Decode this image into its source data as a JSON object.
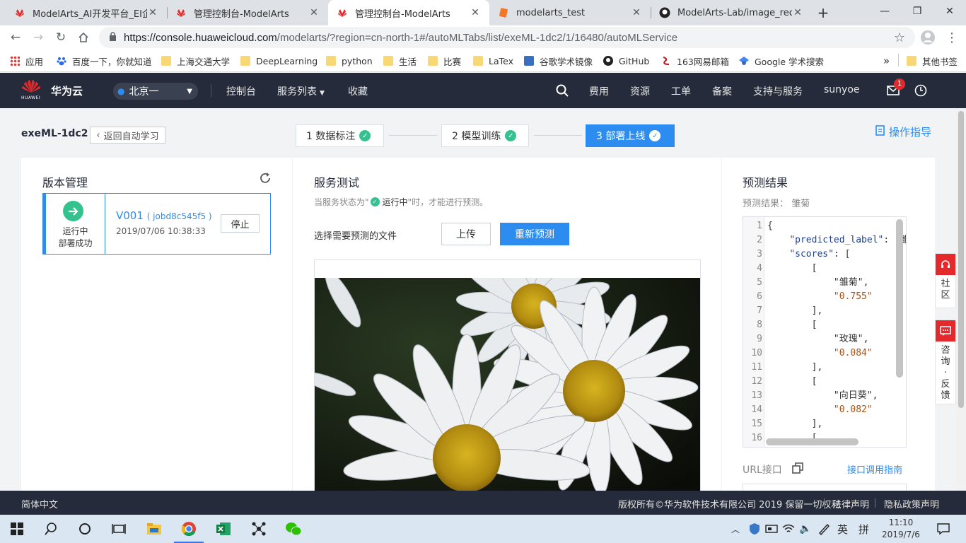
{
  "browser": {
    "tabs": [
      {
        "title": "ModelArts_AI开发平台_EI企业",
        "active": false
      },
      {
        "title": "管理控制台-ModelArts",
        "active": false
      },
      {
        "title": "管理控制台-ModelArts",
        "active": true
      },
      {
        "title": "modelarts_test",
        "active": false
      },
      {
        "title": "ModelArts-Lab/image_recog",
        "active": false
      }
    ],
    "url_host": "https://console.huaweicloud.com",
    "url_path": "/modelarts/?region=cn-north-1#/autoMLTabs/list/exeML-1dc2/1/16480/autoMLService",
    "bookmarks": [
      "应用",
      "百度一下，你就知道",
      "上海交通大学",
      "DeepLearning",
      "python",
      "生活",
      "比赛",
      "LaTex",
      "谷歌学术镜像",
      "GitHub",
      "163网易邮箱",
      "Google 学术搜索"
    ],
    "bookmarks_more": "»",
    "other_bookmarks": "其他书签"
  },
  "header": {
    "logo_text": "HUAWEI",
    "brand": "华为云",
    "region": "北京一",
    "nav": [
      "控制台",
      "服务列表",
      "收藏"
    ],
    "right_nav": [
      "费用",
      "资源",
      "工单",
      "备案",
      "支持与服务",
      "sunyoe"
    ],
    "mail_badge": "1"
  },
  "page": {
    "project_name": "exeML-1dc2",
    "back_label": "返回自动学习",
    "steps": [
      {
        "label": "1 数据标注",
        "active": false
      },
      {
        "label": "2 模型训练",
        "active": false
      },
      {
        "label": "3 部署上线",
        "active": true
      }
    ],
    "guide_label": "操作指导"
  },
  "version_panel": {
    "title": "版本管理",
    "status_line1": "运行中",
    "status_line2": "部署成功",
    "version": "V001",
    "job_id": "( jobd8c545f5 )",
    "datetime": "2019/07/06 10:38:33",
    "stop_label": "停止"
  },
  "service_test": {
    "title": "服务测试",
    "hint_prefix": "当服务状态为\"",
    "hint_status": "运行中",
    "hint_suffix": "\"时，才能进行预测。",
    "select_label": "选择需要预测的文件",
    "upload_label": "上传",
    "repredict_label": "重新预测"
  },
  "prediction": {
    "title": "预测结果",
    "result_label": "预测结果：",
    "result_value": "雏菊",
    "line_numbers": [
      "1",
      "2",
      "3",
      "4",
      "5",
      "6",
      "7",
      "8",
      "9",
      "10",
      "11",
      "12",
      "13",
      "14",
      "15",
      "16"
    ],
    "code_lines": [
      "{",
      "    \"predicted_label\": \"雏菊\",",
      "    \"scores\": [",
      "        [",
      "            \"雏菊\",",
      "            \"0.755\"",
      "        ],",
      "        [",
      "            \"玫瑰\",",
      "            \"0.084\"",
      "        ],",
      "        [",
      "            \"向日葵\",",
      "            \"0.082\"",
      "        ],",
      "        ["
    ],
    "url_label": "URL接口",
    "api_guide": "接口调用指南"
  },
  "side_float": {
    "community": "社区",
    "consult": "咨询·反馈"
  },
  "footer": {
    "lang": "简体中文",
    "copyright": "版权所有©华为软件技术有限公司 2019 保留一切权利",
    "legal": "法律声明",
    "privacy": "隐私政策声明"
  },
  "taskbar": {
    "time": "11:10",
    "date": "2019/7/6",
    "ime": "英",
    "ime2": "拼"
  }
}
